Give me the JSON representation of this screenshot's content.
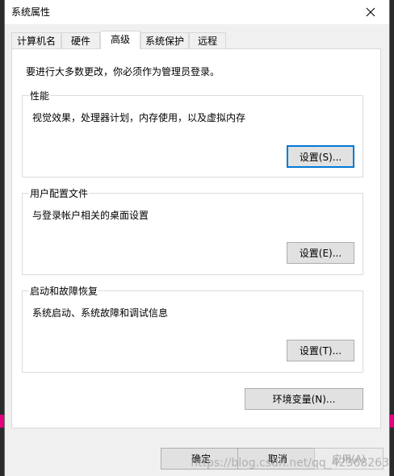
{
  "window": {
    "title": "系统属性"
  },
  "tabs": [
    {
      "label": "计算机名",
      "active": false
    },
    {
      "label": "硬件",
      "active": false
    },
    {
      "label": "高级",
      "active": true
    },
    {
      "label": "系统保护",
      "active": false
    },
    {
      "label": "远程",
      "active": false
    }
  ],
  "notice": "要进行大多数更改，你必须作为管理员登录。",
  "groups": {
    "performance": {
      "title": "性能",
      "description": "视觉效果，处理器计划，内存使用，以及虚拟内存",
      "button": "设置(S)..."
    },
    "user_profiles": {
      "title": "用户配置文件",
      "description": "与登录帐户相关的桌面设置",
      "button": "设置(E)..."
    },
    "startup_recovery": {
      "title": "启动和故障恢复",
      "description": "系统启动、系统故障和调试信息",
      "button": "设置(T)..."
    }
  },
  "env_button": "环境变量(N)...",
  "footer": {
    "ok": "确定",
    "cancel": "取消",
    "apply": "应用(A)"
  },
  "watermark": "https://blog.csdn.net/qq_42368263",
  "colors": {
    "accent": "#0078d7",
    "panel": "#ffffff",
    "dialog": "#f0f0f0",
    "background_strip": "#e4007f"
  }
}
